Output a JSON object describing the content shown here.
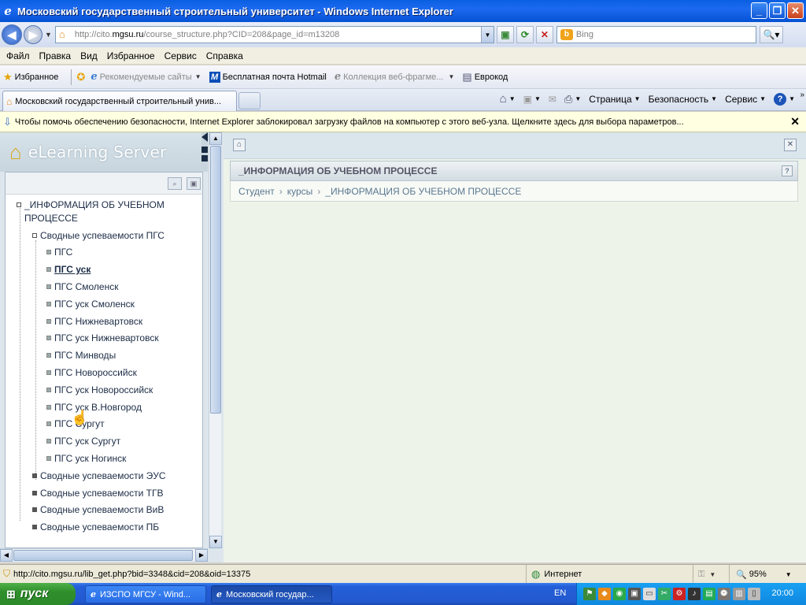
{
  "window": {
    "title": "Московский государственный строительный университет - Windows Internet Explorer"
  },
  "address": {
    "url_prefix": "http://cito.",
    "url_domain": "mgsu.ru",
    "url_rest": "/course_structure.php?CID=208&page_id=m13208",
    "search_placeholder": "Bing"
  },
  "menu": [
    "Файл",
    "Правка",
    "Вид",
    "Избранное",
    "Сервис",
    "Справка"
  ],
  "favorites": {
    "label": "Избранное",
    "items": [
      {
        "label": "Рекомендуемые сайты",
        "icon": "ie-icon",
        "dim": true
      },
      {
        "label": "Бесплатная почта Hotmail",
        "icon": "msn-icon",
        "dim": false
      },
      {
        "label": "Коллекция веб-фрагме...",
        "icon": "webslice-icon",
        "dim": true
      },
      {
        "label": "Еврокод",
        "icon": "page-icon",
        "dim": false
      }
    ]
  },
  "tabs": {
    "active_label": "Московский государственный строительный унив..."
  },
  "commandbar": {
    "page": "Страница",
    "security": "Безопасность",
    "tools": "Сервис"
  },
  "infobar": {
    "text": "Чтобы помочь обеспечению безопасности, Internet Explorer заблокировал загрузку файлов на компьютер с этого веб-узла. Щелкните здесь для выбора параметров..."
  },
  "sidebar": {
    "logo": "eLearning Server",
    "tree": {
      "root": "_ИНФОРМАЦИЯ ОБ УЧЕБНОМ ПРОЦЕССЕ",
      "root_line1": "_ИНФОРМАЦИЯ ОБ УЧЕБНОМ",
      "root_line2": "ПРОЦЕССЕ",
      "group_open": "Сводные успеваемости ПГС",
      "children": [
        "ПГС",
        "ПГС уск",
        "ПГС Смоленск",
        "ПГС уск Смоленск",
        "ПГС Нижневартовск",
        "ПГС уск Нижневартовск",
        "ПГС Минводы",
        "ПГС Новороссийск",
        "ПГС уск Новороссийск",
        "ПГС уск В.Новгород",
        "ПГС Сургут",
        "ПГС уск Сургут",
        "ПГС уск Ногинск"
      ],
      "active_child": 1,
      "groups_closed": [
        "Сводные успеваемости ЭУС",
        "Сводные успеваемости ТГВ",
        "Сводные успеваемости ВиВ",
        "Сводные успеваемости ПБ"
      ]
    }
  },
  "content": {
    "title": "_ИНФОРМАЦИЯ ОБ УЧЕБНОМ ПРОЦЕССЕ",
    "breadcrumbs": [
      "Студент",
      "курсы",
      "_ИНФОРМАЦИЯ ОБ УЧЕБНОМ ПРОЦЕССЕ"
    ]
  },
  "statusbar": {
    "url": "http://cito.mgsu.ru/lib_get.php?bid=3348&cid=208&oid=13375",
    "zone": "Интернет",
    "zoom": "95%"
  },
  "taskbar": {
    "start": "пуск",
    "items": [
      "ИЗСПО МГСУ - Wind...",
      "Московский государ..."
    ],
    "lang": "EN",
    "clock": "20:00"
  }
}
